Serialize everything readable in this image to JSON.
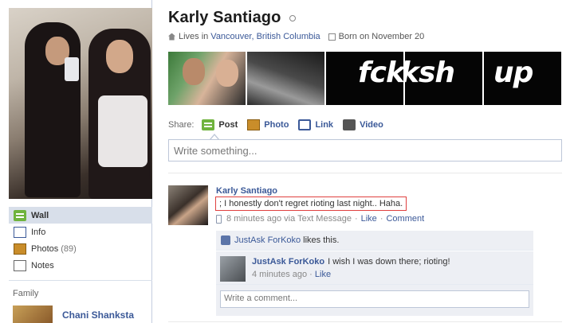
{
  "profile": {
    "name": "Karly Santiago",
    "lives_prefix": "Lives in",
    "location": "Vancouver, British Columbia",
    "birthday": "Born on November 20"
  },
  "photo_strip": {
    "texts": [
      "fck",
      "ksh",
      "up"
    ]
  },
  "nav": {
    "items": [
      {
        "label": "Wall",
        "icon": "wall-icon",
        "active": true
      },
      {
        "label": "Info",
        "icon": "info-icon"
      },
      {
        "label": "Photos",
        "count": "(89)",
        "icon": "photos-icon"
      },
      {
        "label": "Notes",
        "icon": "notes-icon"
      }
    ]
  },
  "family": {
    "title": "Family",
    "member_name": "Chani Shanksta"
  },
  "share": {
    "label": "Share:",
    "options": [
      {
        "label": "Post",
        "icon": "post-icon"
      },
      {
        "label": "Photo",
        "icon": "photo-icon"
      },
      {
        "label": "Link",
        "icon": "link-icon"
      },
      {
        "label": "Video",
        "icon": "video-icon"
      }
    ],
    "placeholder": "Write something..."
  },
  "post": {
    "author": "Karly Santiago",
    "message": "; I honestly don't regret rioting last night.. Haha.",
    "time": "8 minutes ago via Text Message",
    "like_label": "Like",
    "comment_label": "Comment",
    "likes_name": "JustAsk ForKoko",
    "likes_suffix": "likes this.",
    "comment": {
      "author": "JustAsk ForKoko",
      "text": "I wish I was down there; rioting!",
      "time": "4 minutes ago",
      "like_label": "Like"
    },
    "write_comment_placeholder": "Write a comment..."
  },
  "colors": {
    "link": "#3b5998",
    "highlight_border": "#e0403f",
    "active_nav_bg": "#d8dfea"
  }
}
